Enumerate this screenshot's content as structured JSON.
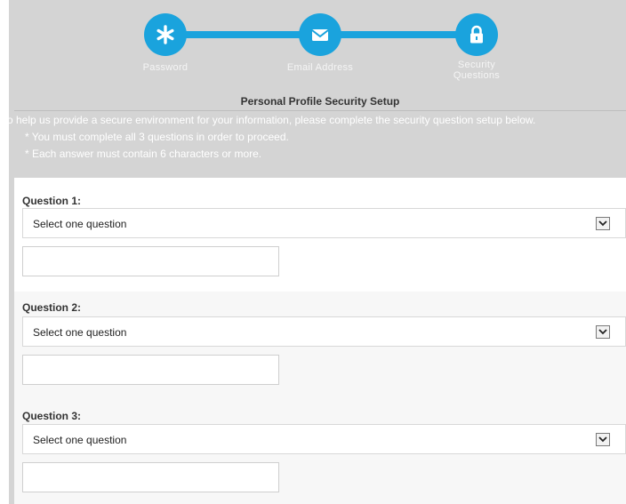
{
  "stepper": {
    "steps": [
      {
        "label": "Password",
        "icon": "asterisk-icon"
      },
      {
        "label": "Email Address",
        "icon": "envelope-icon"
      },
      {
        "label_line1": "Security",
        "label_line2": "Questions",
        "icon": "lock-icon"
      }
    ],
    "accent_color": "#1aa3dd"
  },
  "page": {
    "title": "Personal Profile Security Setup",
    "intro": "To help us provide a secure environment for your information, please complete the security question setup below.",
    "bullets": [
      "* You must complete all 3 questions in order to proceed.",
      "* Each answer must contain 6 characters or more."
    ]
  },
  "questions": [
    {
      "label": "Question 1:",
      "select_value": "Select one question",
      "answer_value": ""
    },
    {
      "label": "Question 2:",
      "select_value": "Select one question",
      "answer_value": ""
    },
    {
      "label": "Question 3:",
      "select_value": "Select one question",
      "answer_value": ""
    }
  ]
}
